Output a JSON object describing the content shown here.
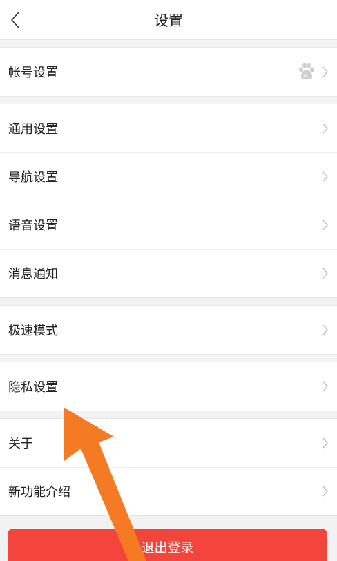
{
  "header": {
    "title": "设置",
    "back_icon": "chevron-left-icon"
  },
  "groups": [
    {
      "items": [
        {
          "label": "帐号设置",
          "badge_icon": "baidu-paw-icon"
        }
      ]
    },
    {
      "items": [
        {
          "label": "通用设置"
        },
        {
          "label": "导航设置"
        },
        {
          "label": "语音设置"
        },
        {
          "label": "消息通知"
        }
      ]
    },
    {
      "items": [
        {
          "label": "极速模式"
        }
      ]
    },
    {
      "items": [
        {
          "label": "隐私设置"
        }
      ]
    },
    {
      "items": [
        {
          "label": "关于"
        },
        {
          "label": "新功能介绍"
        }
      ]
    }
  ],
  "logout": {
    "label": "退出登录",
    "color": "#f4453d"
  },
  "annotation": {
    "type": "orange-arrow",
    "color": "#f47a24",
    "points_to": "隐私设置"
  }
}
